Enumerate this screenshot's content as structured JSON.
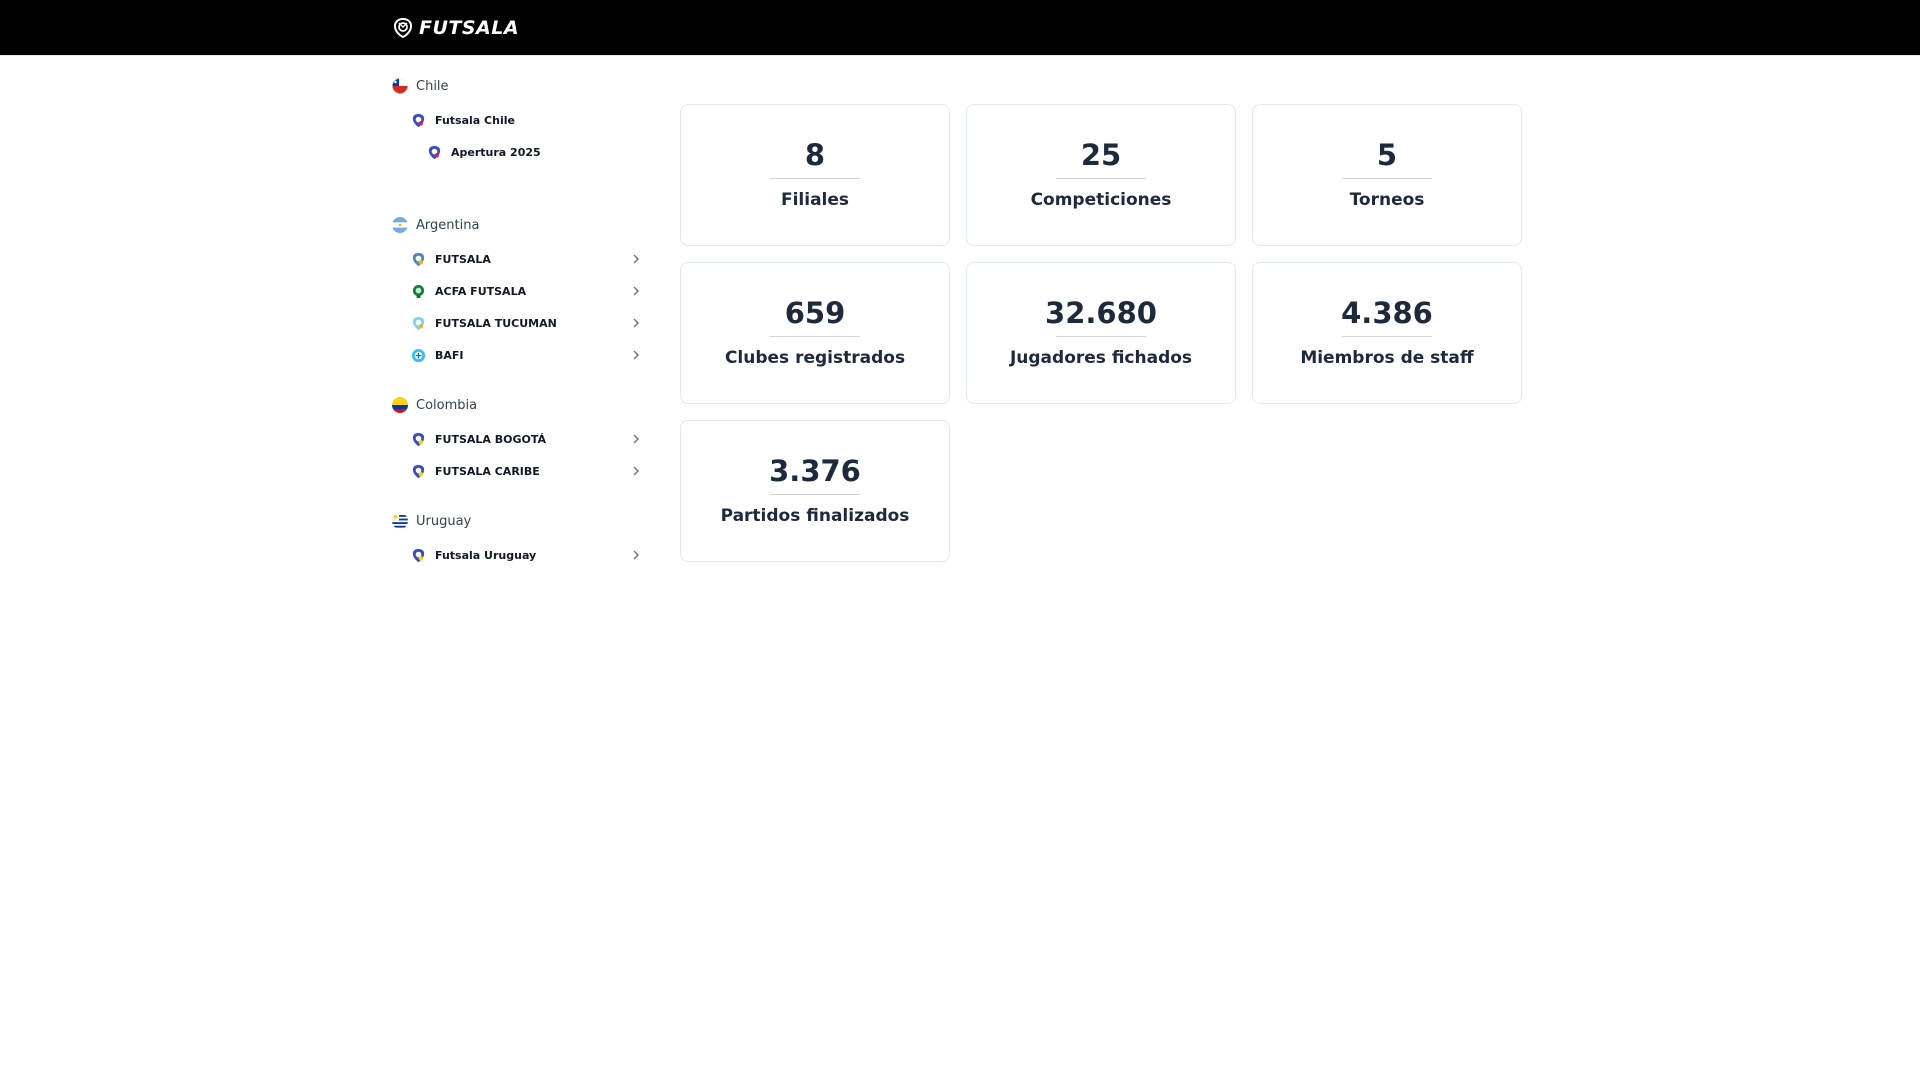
{
  "header": {
    "logo_text": "FUTSALA",
    "logo_icon": "ball-shield-icon",
    "background": "#000000"
  },
  "sidebar": {
    "countries": [
      {
        "name": "Chile",
        "flag_icon": "chile-flag-icon",
        "orgs": [
          {
            "name": "Futsala Chile",
            "icon": "futsala-shield-icon",
            "expandable": false
          },
          {
            "name": "Apertura 2025",
            "icon": "futsala-shield-icon",
            "expandable": false,
            "level": 2
          }
        ]
      },
      {
        "name": "Argentina",
        "flag_icon": "argentina-flag-icon",
        "orgs": [
          {
            "name": "FUTSALA",
            "icon": "futsala-shield-icon",
            "expandable": true
          },
          {
            "name": "ACFA FUTSALA",
            "icon": "acfa-logo-icon",
            "expandable": true
          },
          {
            "name": "FUTSALA TUCUMAN",
            "icon": "futsala-shield-icon",
            "expandable": true
          },
          {
            "name": "BAFI",
            "icon": "bafi-logo-icon",
            "expandable": true
          }
        ]
      },
      {
        "name": "Colombia",
        "flag_icon": "colombia-flag-icon",
        "orgs": [
          {
            "name": "FUTSALA BOGOTÁ",
            "icon": "futsala-shield-icon",
            "expandable": true
          },
          {
            "name": "FUTSALA CARIBE",
            "icon": "futsala-shield-icon",
            "expandable": true
          }
        ]
      },
      {
        "name": "Uruguay",
        "flag_icon": "uruguay-flag-icon",
        "orgs": [
          {
            "name": "Futsala Uruguay",
            "icon": "futsala-shield-icon",
            "expandable": true
          }
        ]
      }
    ]
  },
  "stats": [
    {
      "value": "8",
      "label": "Filiales"
    },
    {
      "value": "25",
      "label": "Competiciones"
    },
    {
      "value": "5",
      "label": "Torneos"
    },
    {
      "value": "659",
      "label": "Clubes registrados"
    },
    {
      "value": "32.680",
      "label": "Jugadores fichados"
    },
    {
      "value": "4.386",
      "label": "Miembros de staff"
    },
    {
      "value": "3.376",
      "label": "Partidos finalizados"
    }
  ],
  "colors": {
    "text": "#1e293b",
    "card_border": "#e2e8f0",
    "chile_red": "#d52b1e",
    "chile_blue": "#0039a6",
    "argentina_blue": "#74acdf",
    "colombia_yellow": "#fcd116",
    "colombia_blue": "#003893",
    "colombia_red": "#ce1126",
    "uruguay_blue": "#0038a8",
    "futsala_shield_blue": "#3b4cc0",
    "futsala_shield_red": "#e11d48",
    "acfa_green": "#15803d",
    "bafi_blue": "#38bdf8"
  }
}
